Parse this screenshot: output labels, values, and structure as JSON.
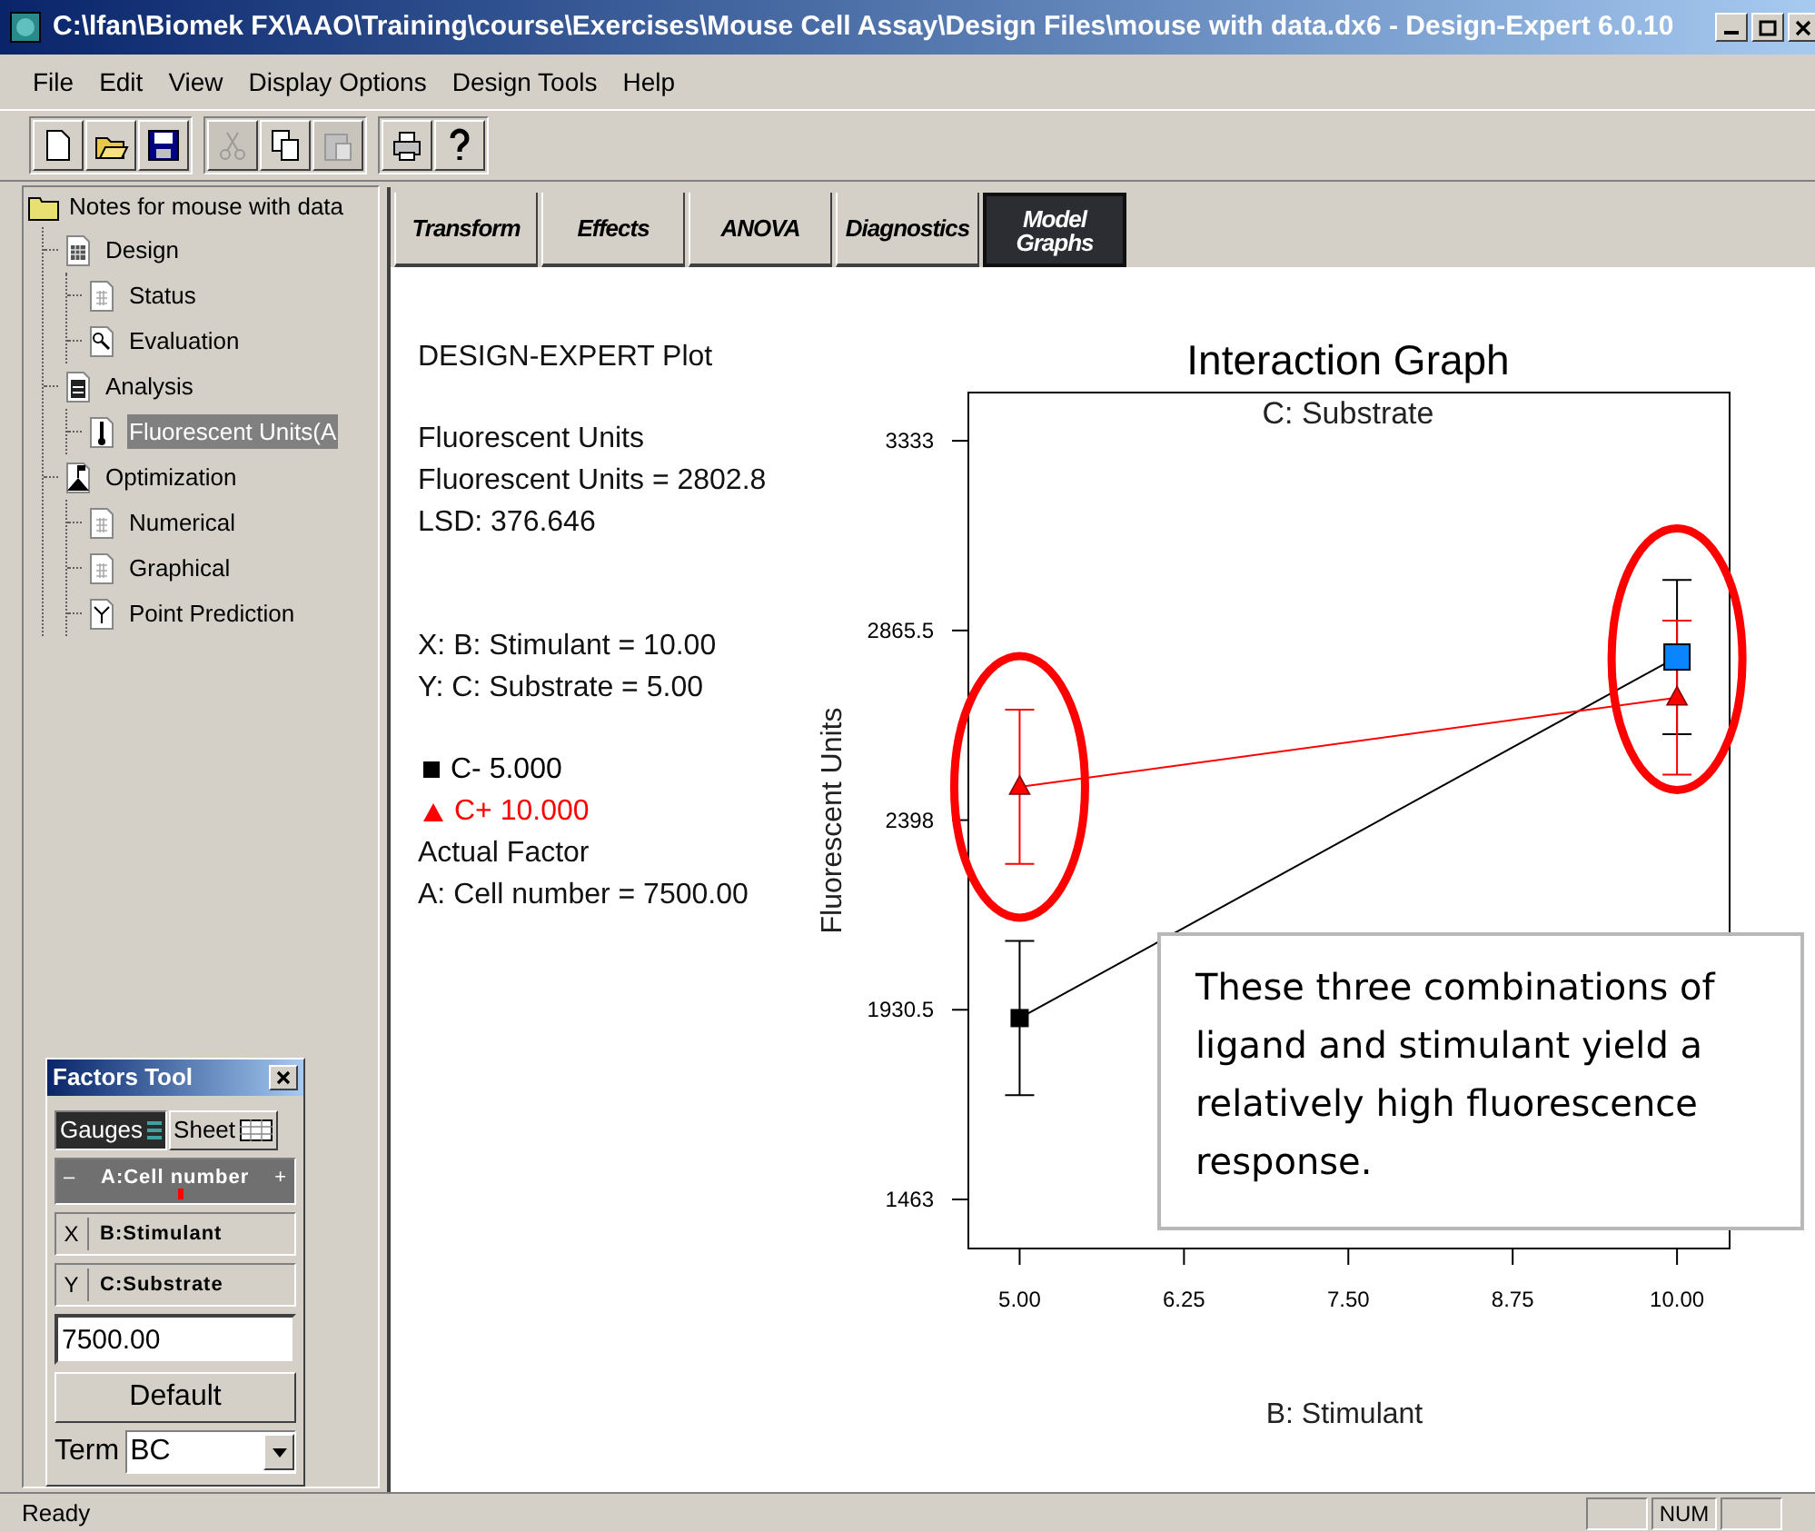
{
  "window": {
    "title": "C:\\lfan\\Biomek FX\\AAO\\Training\\course\\Exercises\\Mouse Cell Assay\\Design Files\\mouse with data.dx6 - Design-Expert 6.0.10"
  },
  "menu": [
    {
      "label": "File"
    },
    {
      "label": "Edit"
    },
    {
      "label": "View"
    },
    {
      "label": "Display Options"
    },
    {
      "label": "Design Tools"
    },
    {
      "label": "Help"
    }
  ],
  "toolbar": [
    {
      "buttons": [
        {
          "kind": "new",
          "disabled": false
        },
        {
          "kind": "open",
          "disabled": false
        },
        {
          "kind": "save",
          "disabled": false
        }
      ]
    },
    {
      "buttons": [
        {
          "kind": "cut",
          "disabled": true
        },
        {
          "kind": "copy",
          "disabled": false
        },
        {
          "kind": "paste",
          "disabled": true
        }
      ]
    },
    {
      "buttons": [
        {
          "kind": "print",
          "disabled": false
        },
        {
          "kind": "help",
          "disabled": false
        }
      ]
    }
  ],
  "tree": {
    "label": "Notes for mouse with data",
    "kind": "folder",
    "selected": false,
    "children": [
      {
        "label": "Design",
        "kind": "table",
        "selected": false,
        "children": [
          {
            "label": "Status",
            "kind": "page",
            "selected": false
          },
          {
            "label": "Evaluation",
            "kind": "search",
            "selected": false
          }
        ]
      },
      {
        "label": "Analysis",
        "kind": "calc",
        "selected": false,
        "children": [
          {
            "label": "Fluorescent Units(A",
            "kind": "thermo",
            "selected": true
          }
        ]
      },
      {
        "label": "Optimization",
        "kind": "flag",
        "selected": false,
        "children": [
          {
            "label": "Numerical",
            "kind": "page",
            "selected": false
          },
          {
            "label": "Graphical",
            "kind": "page",
            "selected": false
          },
          {
            "label": "Point Prediction",
            "kind": "predict",
            "selected": false
          }
        ]
      }
    ]
  },
  "factors_tool": {
    "title": "Factors Tool",
    "modes": [
      {
        "label": "Gauges",
        "selected": true
      },
      {
        "label": "Sheet",
        "selected": false
      }
    ],
    "factors": [
      {
        "kind": "gauge",
        "label": "A:Cell number",
        "minus": "–",
        "plus": "+"
      },
      {
        "kind": "axis",
        "axis": "X",
        "label": "B:Stimulant"
      },
      {
        "kind": "axis",
        "axis": "Y",
        "label": "C:Substrate"
      }
    ],
    "value": "7500.00",
    "default_button": "Default",
    "term_label": "Term",
    "term_value": "BC"
  },
  "tabs": [
    {
      "label": "Transform",
      "selected": false
    },
    {
      "label": "Effects",
      "selected": false
    },
    {
      "label": "ANOVA",
      "selected": false
    },
    {
      "label": "Diagnostics",
      "selected": false
    },
    {
      "label": "Model Graphs",
      "selected": true
    }
  ],
  "plot_info": {
    "heading": "DESIGN-EXPERT Plot",
    "response": [
      "Fluorescent Units",
      "Fluorescent Units = 2802.8",
      "LSD: 376.646"
    ],
    "axes": [
      "X: B: Stimulant = 10.00",
      "Y: C: Substrate = 5.00"
    ],
    "actual_heading": "Actual Factor",
    "actual": [
      "A: Cell number = 7500.00"
    ]
  },
  "graph": {
    "selected_points": [
      [
        false,
        true
      ],
      [
        false,
        false
      ]
    ],
    "chart_data": {
      "type": "line",
      "title": "Interaction Graph",
      "subtitle": "C: Substrate",
      "xlabel": "B: Stimulant",
      "ylabel": "Fluorescent Units",
      "x": [
        5,
        10
      ],
      "series": [
        {
          "name": "C- 5.000",
          "color": "#000000",
          "marker": "square",
          "values": [
            1910,
            2800
          ],
          "errors": [
            190,
            190
          ]
        },
        {
          "name": "C+ 10.000",
          "color": "#ff0000",
          "marker": "triangle",
          "values": [
            2480,
            2700
          ],
          "errors": [
            190,
            190
          ]
        }
      ],
      "xlim": [
        4.61,
        10.4
      ],
      "ylim": [
        1342,
        3452
      ],
      "xticks": [
        {
          "value": 5,
          "label": "5.00"
        },
        {
          "value": 6.25,
          "label": "6.25"
        },
        {
          "value": 7.5,
          "label": "7.50"
        },
        {
          "value": 8.75,
          "label": "8.75"
        },
        {
          "value": 10,
          "label": "10.00"
        }
      ],
      "yticks": [
        {
          "value": 1463,
          "label": "1463"
        },
        {
          "value": 1930.5,
          "label": "1930.5"
        },
        {
          "value": 2398,
          "label": "2398"
        },
        {
          "value": 2865.5,
          "label": "2865.5"
        },
        {
          "value": 3333,
          "label": "3333"
        }
      ]
    }
  },
  "callout": {
    "text": "These three combinations of ligand and stimulant yield a relatively high fluorescence response."
  },
  "status_bar": {
    "message": "Ready",
    "panels": [
      "NUM"
    ]
  }
}
